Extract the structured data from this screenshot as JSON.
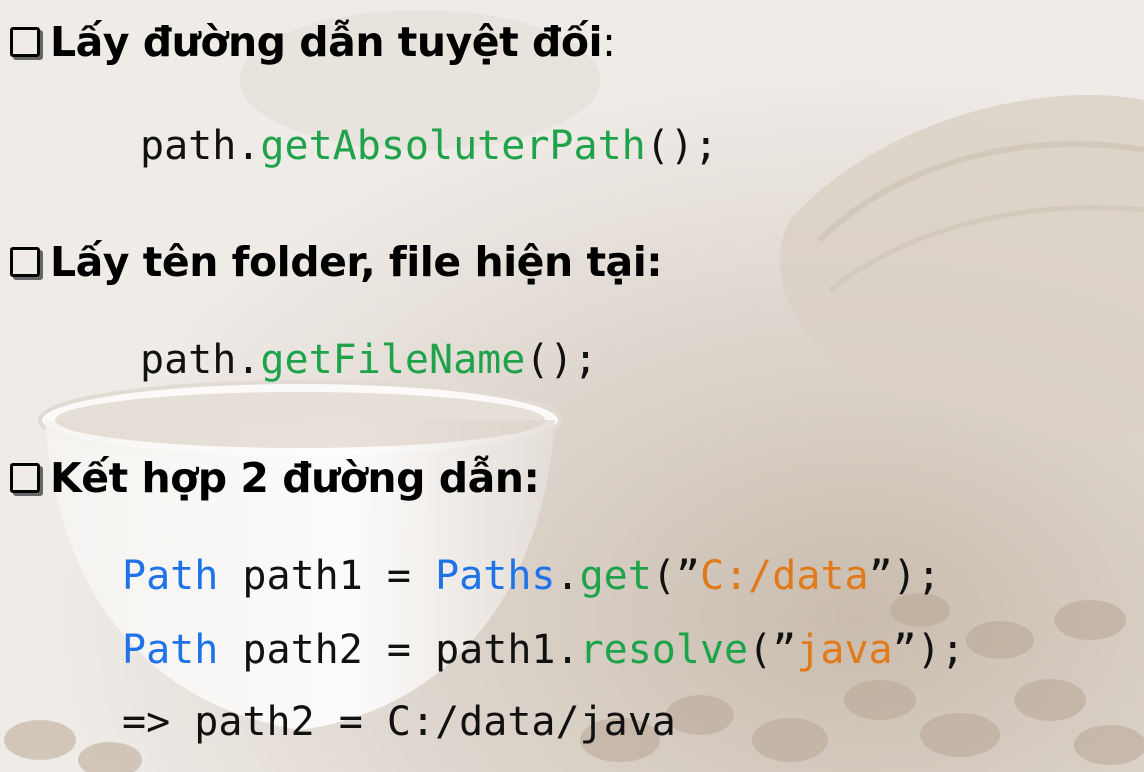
{
  "headings": {
    "absolute": {
      "text": "Lấy đường dẫn tuyệt đối",
      "suffix": ":"
    },
    "filename": {
      "text": "Lấy tên folder, file hiện tại",
      "suffix": ":"
    },
    "combine": {
      "text": "Kết hợp 2 đường dẫn",
      "suffix": ":"
    }
  },
  "code": {
    "absolute": {
      "obj": "path.",
      "method": "getAbsoluterPath",
      "tail": "();"
    },
    "filename": {
      "obj": "path.",
      "method": "getFileName",
      "tail": "();"
    },
    "line1": {
      "type": "Path",
      "mid": " path1 = ",
      "cls": "Paths",
      "dot": ".",
      "method": "get",
      "open": "(”",
      "arg": "C:/data",
      "close": "”);"
    },
    "line2": {
      "type": "Path",
      "mid": " path2 = path1.",
      "method": "resolve",
      "open": "(”",
      "arg": "java",
      "close": "”);"
    },
    "line3": {
      "text": "=> path2 = C:/data/java"
    }
  },
  "colors": {
    "keyword": "#1e73e8",
    "method": "#1fa34a",
    "string": "#e07a1a"
  }
}
